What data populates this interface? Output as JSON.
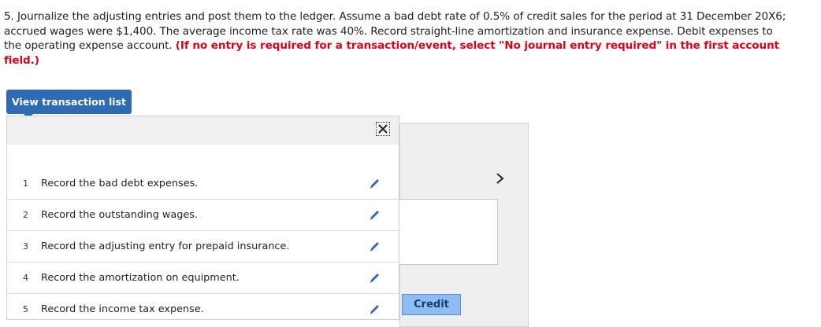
{
  "question": {
    "text": "5. Journalize the adjusting entries and post them to the ledger. Assume a bad debt rate of 0.5% of credit sales for the period at 31 December 20X6; accrued wages were $1,400. The average income tax rate was 40%. Record straight-line amortization and insurance expense. Debit expenses to the operating expense account.",
    "instruction": "(If no entry is required for a transaction/event, select \"No journal entry required\" in the first account field.)"
  },
  "view_button": {
    "label": "View transaction list"
  },
  "popup": {
    "close_icon": "close-icon",
    "transactions": [
      {
        "num": "1",
        "label": "Record the bad debt expenses."
      },
      {
        "num": "2",
        "label": "Record the outstanding wages."
      },
      {
        "num": "3",
        "label": "Record the adjusting entry for prepaid insurance."
      },
      {
        "num": "4",
        "label": "Record the amortization on equipment."
      },
      {
        "num": "5",
        "label": "Record the income tax expense."
      }
    ]
  },
  "panel": {
    "credit_label": "Credit",
    "next_icon": "chevron-right-icon"
  },
  "colors": {
    "accent": "#2e6bb3",
    "emphasis": "#e0001b",
    "credit_bg": "#8fbdf3"
  }
}
